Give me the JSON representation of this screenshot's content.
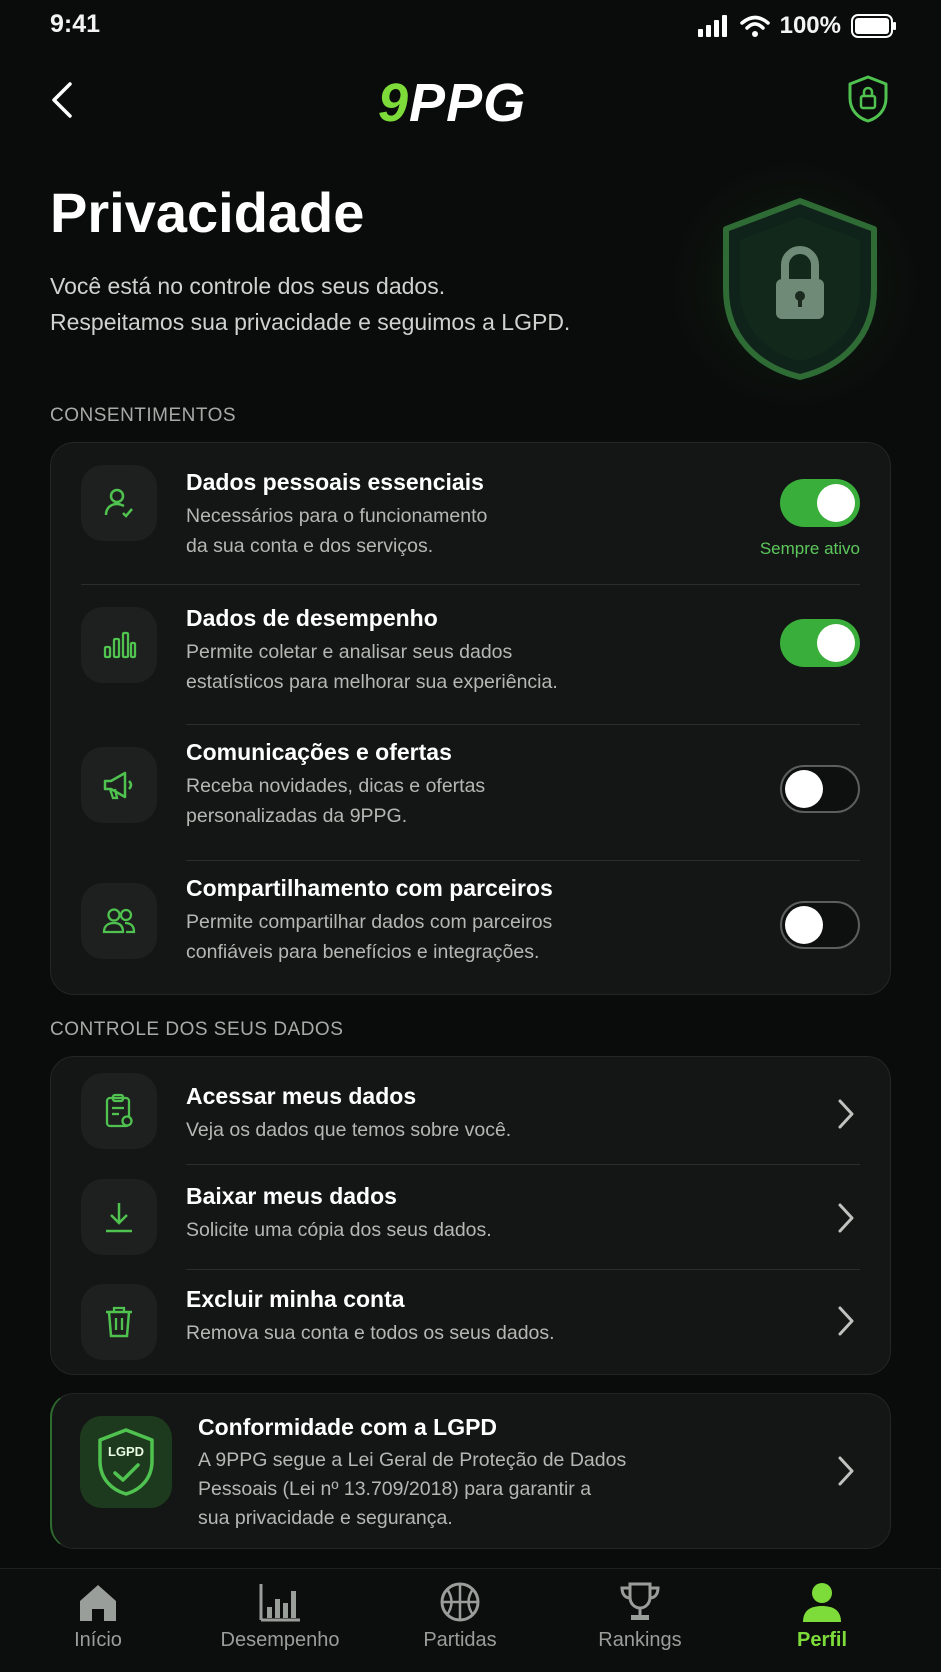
{
  "status_bar": {
    "time": "9:41",
    "battery": "100%"
  },
  "header": {
    "logo_number": "9",
    "logo_text": "PPG"
  },
  "hero": {
    "title": "Privacidade",
    "subtitle_line1": "Você está no controle dos seus dados.",
    "subtitle_line2": "Respeitamos sua privacidade e seguimos a LGPD."
  },
  "consents": {
    "section_label": "CONSENTIMENTOS",
    "items": [
      {
        "title": "Dados pessoais essenciais",
        "desc_line1": "Necessários para o funcionamento",
        "desc_line2": "da sua conta e dos serviços.",
        "enabled": true,
        "badge": "Sempre ativo",
        "icon": "user-check-icon"
      },
      {
        "title": "Dados de desempenho",
        "desc_line1": "Permite coletar e analisar seus dados",
        "desc_line2": "estatísticos para melhorar sua experiência.",
        "enabled": true,
        "icon": "bar-chart-icon"
      },
      {
        "title": "Comunicações e ofertas",
        "desc_line1": "Receba novidades, dicas e ofertas",
        "desc_line2": "personalizadas da 9PPG.",
        "enabled": false,
        "icon": "megaphone-icon"
      },
      {
        "title": "Compartilhamento com parceiros",
        "desc_line1": "Permite compartilhar dados com parceiros",
        "desc_line2": "confiáveis para benefícios e integrações.",
        "enabled": false,
        "icon": "users-icon"
      }
    ]
  },
  "data_control": {
    "section_label": "CONTROLE DOS SEUS DADOS",
    "items": [
      {
        "title": "Acessar meus dados",
        "desc": "Veja os dados que temos sobre você.",
        "icon": "clipboard-icon"
      },
      {
        "title": "Baixar meus dados",
        "desc": "Solicite uma cópia dos seus dados.",
        "icon": "download-icon"
      },
      {
        "title": "Excluir minha conta",
        "desc": "Remova sua conta e todos os seus dados.",
        "icon": "trash-icon"
      }
    ]
  },
  "lgpd": {
    "badge_text": "LGPD",
    "title": "Conformidade com a LGPD",
    "line1": "A 9PPG segue a Lei Geral de Proteção de Dados",
    "line2": "Pessoais (Lei nº 13.709/2018) para garantir a",
    "line3": "sua privacidade e segurança."
  },
  "tabs": [
    {
      "label": "Início",
      "icon": "home-icon"
    },
    {
      "label": "Desempenho",
      "icon": "stats-icon"
    },
    {
      "label": "Partidas",
      "icon": "ball-icon"
    },
    {
      "label": "Rankings",
      "icon": "trophy-icon"
    },
    {
      "label": "Perfil",
      "icon": "profile-icon",
      "active": true
    }
  ],
  "colors": {
    "accent": "#7ddc3a",
    "toggle_on": "#3aae3a",
    "background": "#0a0b0b",
    "card": "#141615"
  }
}
